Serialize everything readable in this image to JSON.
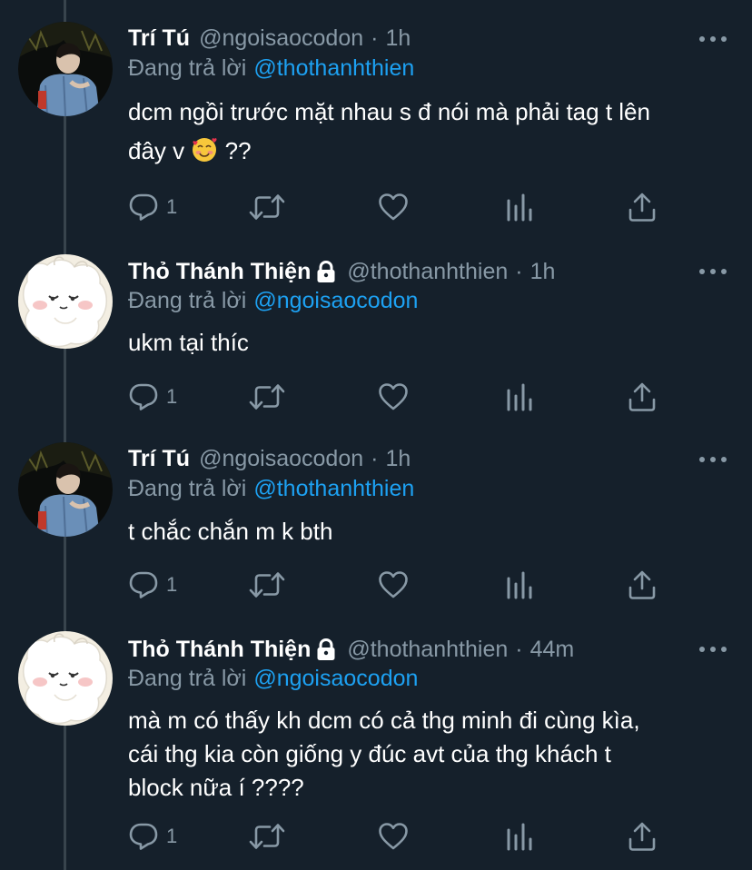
{
  "tweets": [
    {
      "name": "Trí Tú",
      "handle": "@ngoisaocodon",
      "time": "1h",
      "reply_prefix": "Đang trả lời",
      "reply_to": "@thothanhthien",
      "text_line1": "dcm ngồi trước mặt nhau s đ nói mà phải tag t lên",
      "text_line2_a": "đây v",
      "text_line2_b": "??",
      "reply_count": "1",
      "protected": false,
      "avatar_icon": "person-photo"
    },
    {
      "name": "Thỏ Thánh Thiện",
      "handle": "@thothanhthien",
      "time": "1h",
      "reply_prefix": "Đang trả lời",
      "reply_to": "@ngoisaocodon",
      "text_line1": "ukm tại thíc",
      "reply_count": "1",
      "protected": true,
      "avatar_icon": "cartoon-bunny"
    },
    {
      "name": "Trí Tú",
      "handle": "@ngoisaocodon",
      "time": "1h",
      "reply_prefix": "Đang trả lời",
      "reply_to": "@thothanhthien",
      "text_line1": "t chắc chắn m k bth",
      "reply_count": "1",
      "protected": false,
      "avatar_icon": "person-photo"
    },
    {
      "name": "Thỏ Thánh Thiện",
      "handle": "@thothanhthien",
      "time": "44m",
      "reply_prefix": "Đang trả lời",
      "reply_to": "@ngoisaocodon",
      "text_line1": "mà m có thấy kh dcm có cả thg minh đi cùng kìa,",
      "text_line2": "cái thg kia còn giống y đúc avt của thg khách t",
      "text_line3": "block nữa í ????",
      "reply_count": "1",
      "protected": true,
      "avatar_icon": "cartoon-bunny"
    }
  ],
  "colors": {
    "background": "#15202b",
    "secondary_text": "#8899a6",
    "accent": "#1da1f2",
    "thread_line": "#38444d"
  },
  "icons": [
    "reply-icon",
    "retweet-icon",
    "like-icon",
    "analytics-icon",
    "share-icon",
    "lock-icon",
    "more-icon"
  ]
}
